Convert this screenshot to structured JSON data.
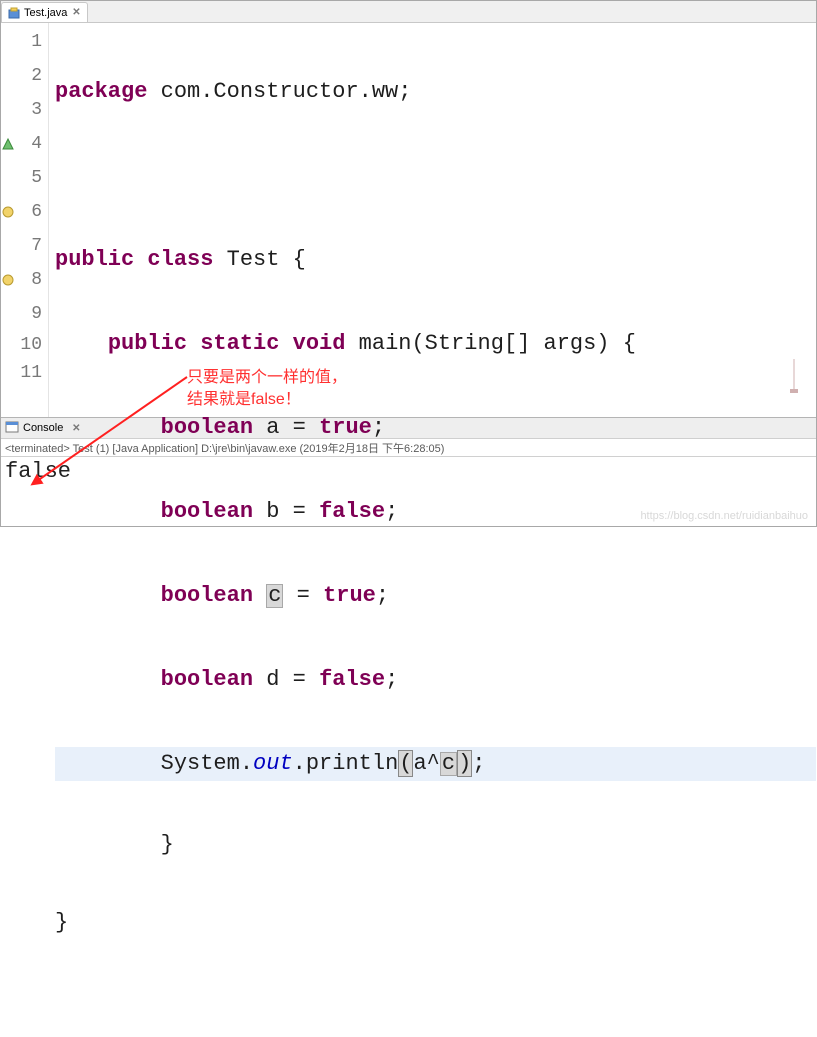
{
  "tab": {
    "label": "Test.java"
  },
  "lines": {
    "l1": {
      "num": "1"
    },
    "l2": {
      "num": "2"
    },
    "l3": {
      "num": "3"
    },
    "l4": {
      "num": "4"
    },
    "l5": {
      "num": "5"
    },
    "l6": {
      "num": "6"
    },
    "l7": {
      "num": "7"
    },
    "l8": {
      "num": "8"
    },
    "l9": {
      "num": "9"
    },
    "l10": {
      "num": "10"
    },
    "l11": {
      "num": "11"
    }
  },
  "code": {
    "pkg_kw": "package",
    "pkg_name": " com.Constructor.ww;",
    "pub": "public",
    "class_kw": "class",
    "class_name": " Test {",
    "static_kw": "static",
    "void_kw": "void",
    "main_sig": " main(String[] args) {",
    "bool_kw": "boolean",
    "true_kw": "true",
    "false_kw": "false",
    "var_a": " a = ",
    "var_b": " b = ",
    "var_c_pre": " ",
    "var_c_name": "c",
    "var_c_eq": " = ",
    "var_d": " d = ",
    "semi": ";",
    "sys": "System.",
    "out": "out",
    "println_open": ".println",
    "paren_open": "(",
    "expr_a": "a^",
    "expr_c": "c",
    "paren_close": ")",
    "close1": "        }",
    "close2": "}"
  },
  "annotation": {
    "line1": "只要是两个一样的值，",
    "line2": "结果就是false！"
  },
  "console": {
    "title": "Console",
    "status": "<terminated> Test (1) [Java Application] D:\\jre\\bin\\javaw.exe (2019年2月18日 下午6:28:05)",
    "output": "false"
  },
  "watermark": "https://blog.csdn.net/ruidianbaihuo"
}
